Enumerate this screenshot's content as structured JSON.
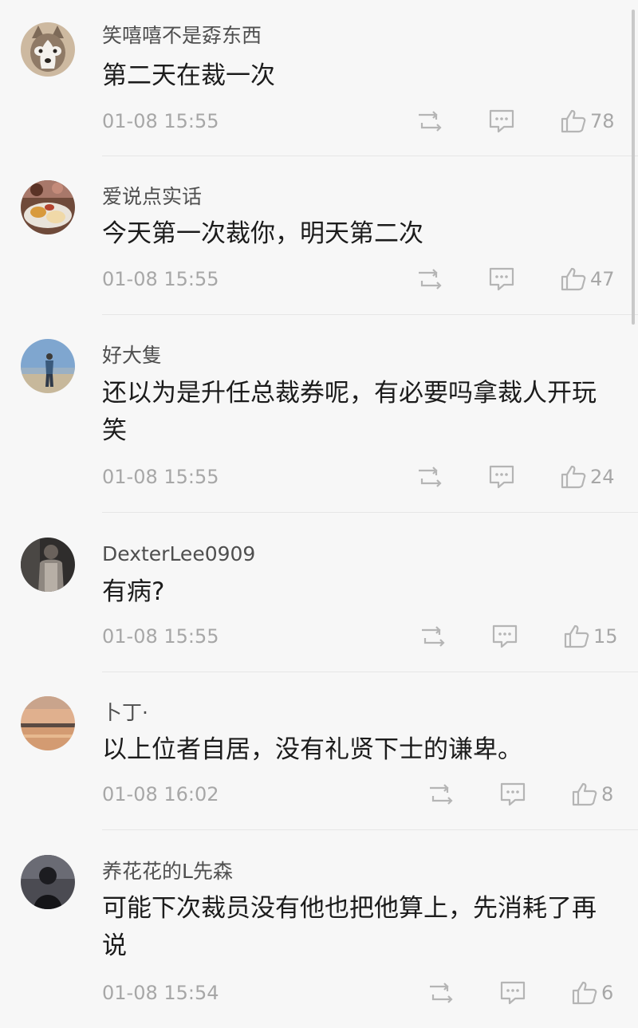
{
  "comments": [
    {
      "username": "笑嘻嘻不是孬东西",
      "avatar_icon": "husky-dog-avatar",
      "text": "第二天在裁一次",
      "time": "01-08 15:55",
      "likes": "78"
    },
    {
      "username": "爱说点实话",
      "avatar_icon": "food-table-avatar",
      "text": "今天第一次裁你，明天第二次",
      "time": "01-08 15:55",
      "likes": "47"
    },
    {
      "username": "好大隻",
      "avatar_icon": "person-on-beach-avatar",
      "text": "还以为是升任总裁券呢，有必要吗拿裁人开玩笑",
      "time": "01-08 15:55",
      "likes": "24"
    },
    {
      "username": "DexterLee0909",
      "avatar_icon": "dark-person-avatar",
      "text": "有病?",
      "time": "01-08 15:55",
      "likes": "15"
    },
    {
      "username": "卜丁·",
      "avatar_icon": "sunset-lake-avatar",
      "text": "以上位者自居，没有礼贤下士的谦卑。",
      "time": "01-08 16:02",
      "likes": "8"
    },
    {
      "username": "养花花的L先森",
      "avatar_icon": "dark-figure-avatar",
      "text": "可能下次裁员没有他也把他算上，先消耗了再说",
      "time": "01-08 15:54",
      "likes": "6"
    }
  ],
  "icons": {
    "repost": "repost-icon",
    "reply": "comment-icon",
    "like": "thumbs-up-icon"
  },
  "colors": {
    "background": "#f7f7f7",
    "text": "#1c1c1c",
    "username": "#4f4f4f",
    "meta": "#a7a7a7",
    "divider": "#e6e6e6"
  }
}
